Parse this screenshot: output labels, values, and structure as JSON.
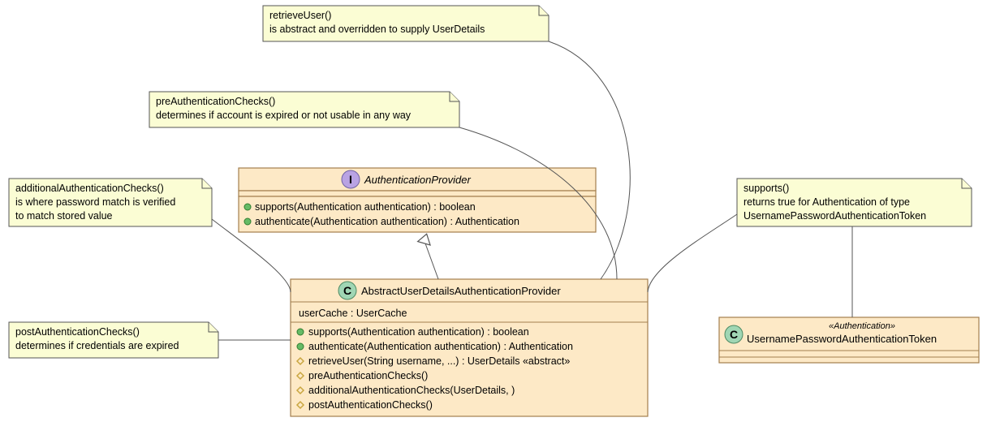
{
  "notes": {
    "retrieveUser": {
      "line1": "retrieveUser()",
      "line2": "is abstract and overridden to supply UserDetails"
    },
    "preAuth": {
      "line1": "preAuthenticationChecks()",
      "line2": "determines if account is expired or not usable in any way"
    },
    "additionalAuth": {
      "line1": "additionalAuthenticationChecks()",
      "line2": "is where password match is verified",
      "line3": "to match stored value"
    },
    "supports": {
      "line1": "supports()",
      "line2": "returns true for Authentication of type",
      "line3": "UsernamePasswordAuthenticationToken"
    },
    "postAuth": {
      "line1": "postAuthenticationChecks()",
      "line2": "determines if credentials are expired"
    }
  },
  "iface": {
    "name": "AuthenticationProvider",
    "members": [
      "supports(Authentication authentication) : boolean",
      "authenticate(Authentication authentication) : Authentication"
    ]
  },
  "klass": {
    "name": "AbstractUserDetailsAuthenticationProvider",
    "field": "userCache : UserCache",
    "members": [
      "supports(Authentication authentication) : boolean",
      "authenticate(Authentication authentication) : Authentication",
      "retrieveUser(String username, ...) : UserDetails «abstract»",
      "preAuthenticationChecks()",
      "additionalAuthenticationChecks(UserDetails, )",
      "postAuthenticationChecks()"
    ]
  },
  "token": {
    "stereotype": "«Authentication»",
    "name": "UsernamePasswordAuthenticationToken"
  },
  "colors": {
    "note": "#FBFDD4",
    "class": "#FDE9C6",
    "border": "#A37F4E"
  }
}
